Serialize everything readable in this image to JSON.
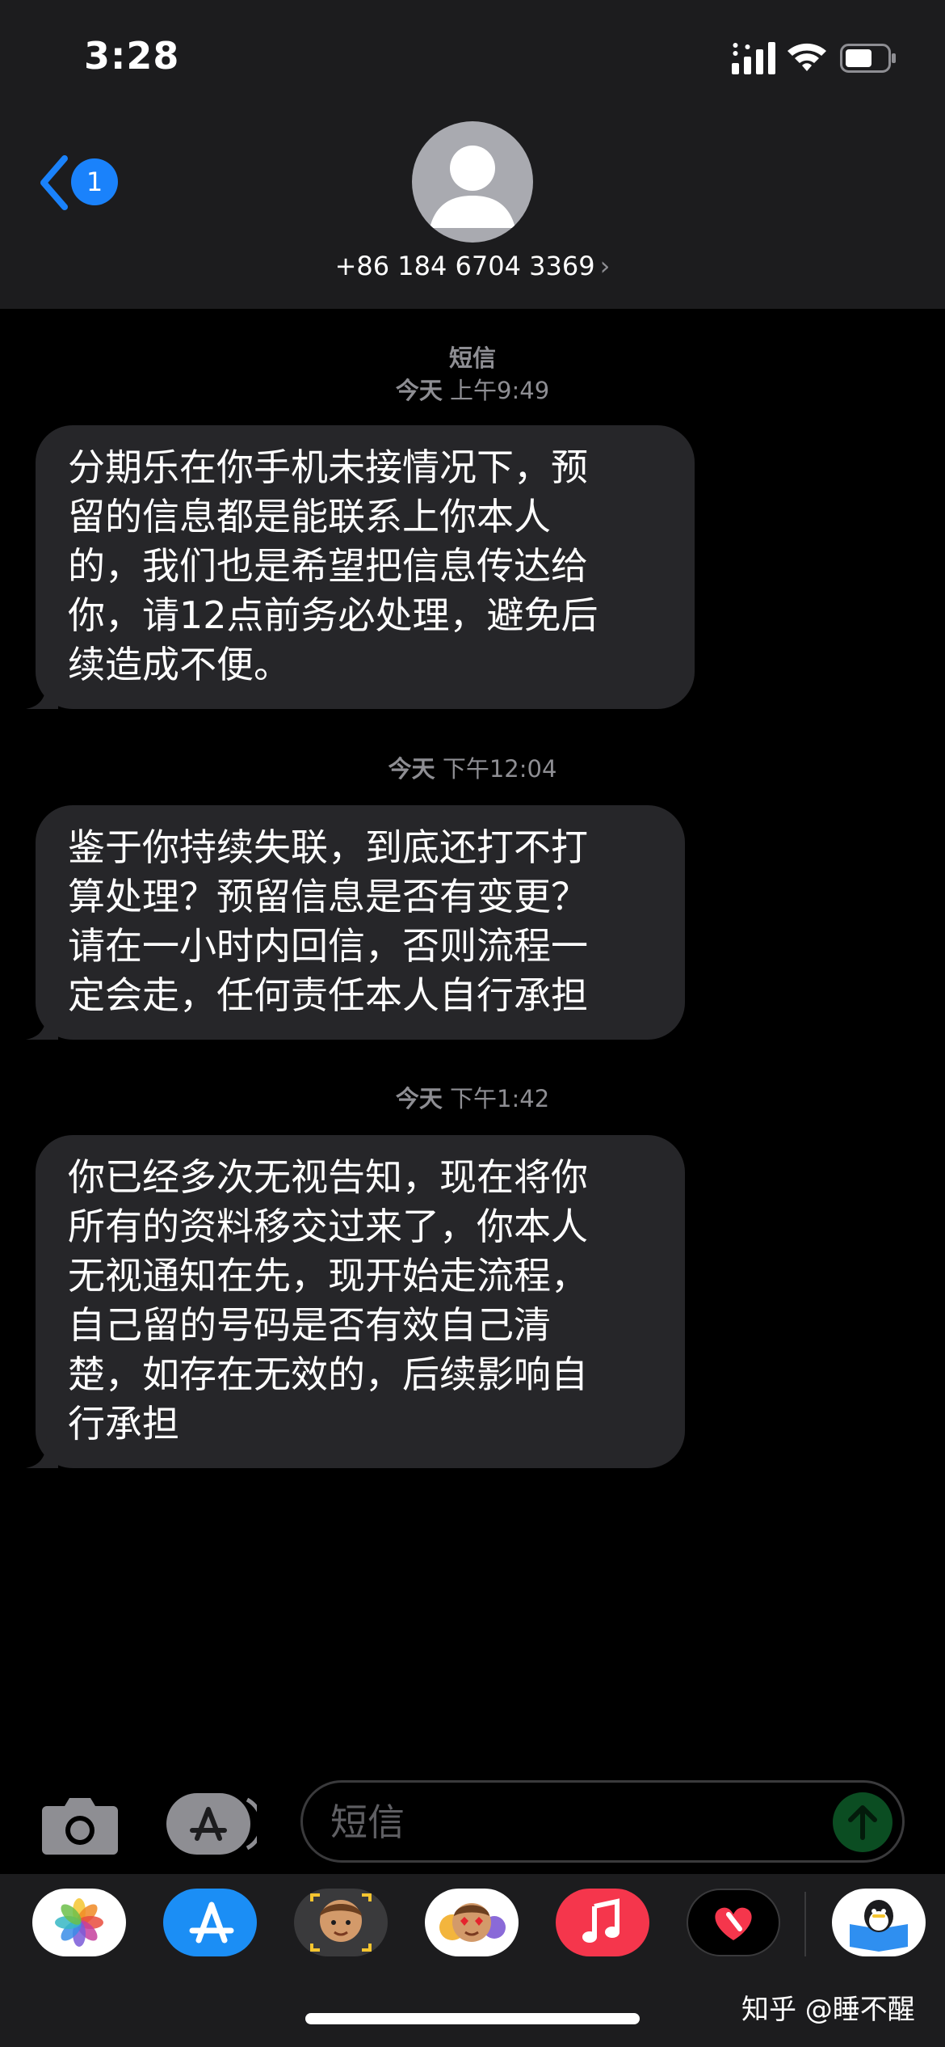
{
  "status_bar": {
    "time": "3:28"
  },
  "header": {
    "back_badge": "1",
    "contact": "+86 184 6704 3369",
    "chevron": "›"
  },
  "thread": {
    "label": "短信",
    "messages": [
      {
        "timestamp_day": "今天",
        "timestamp_time": "上午9:49",
        "lines": [
          "分期乐在你手机未接情况下，预",
          "留的信息都是能联系上你本人",
          "的，我们也是希望把信息传达给",
          "你，请12点前务必处理，避免后",
          "续造成不便。"
        ]
      },
      {
        "timestamp_day": "今天",
        "timestamp_time": "下午12:04",
        "lines": [
          "鉴于你持续失联，到底还打不打",
          "算处理？预留信息是否有变更？",
          "请在一小时内回信，否则流程一",
          "定会走，任何责任本人自行承担"
        ]
      },
      {
        "timestamp_day": "今天",
        "timestamp_time": "下午1:42",
        "lines": [
          "你已经多次无视告知，现在将你",
          "所有的资料移交过来了，你本人",
          "无视通知在先，现开始走流程，",
          "自己留的号码是否有效自己清",
          "楚，如存在无效的，后续影响自",
          "行承担"
        ]
      }
    ]
  },
  "input_bar": {
    "placeholder": "短信"
  },
  "app_strip": {
    "apps": [
      "photos-icon",
      "app-store-icon",
      "memoji-icon",
      "animoji-stickers-icon",
      "music-icon",
      "digital-touch-icon",
      "qq-reader-icon"
    ]
  },
  "watermark": "知乎 @睡不醒",
  "colors": {
    "accent": "#1a82fb",
    "bubble": "#262629",
    "header": "#1c1c1e"
  }
}
